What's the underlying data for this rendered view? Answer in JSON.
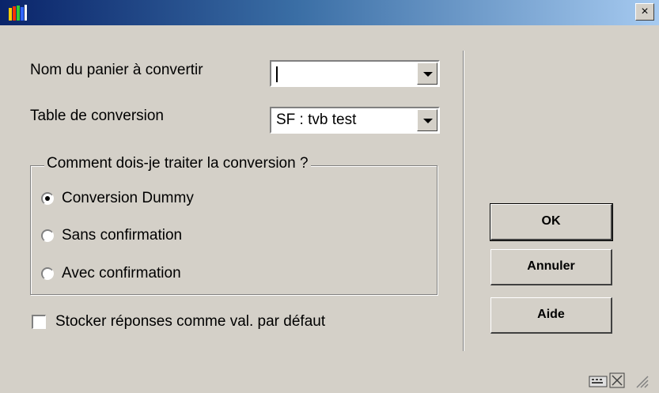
{
  "window": {
    "title": "",
    "close_label": "×"
  },
  "form": {
    "basket_label": "Nom du panier à convertir",
    "basket_value": "",
    "table_label": "Table de conversion",
    "table_value": "SF : tvb test"
  },
  "group": {
    "legend": "Comment dois-je traiter la conversion ?",
    "options": [
      {
        "label": "Conversion Dummy",
        "selected": true
      },
      {
        "label": "Sans confirmation",
        "selected": false
      },
      {
        "label": "Avec confirmation",
        "selected": false
      }
    ]
  },
  "checkbox": {
    "label": "Stocker réponses comme val. par défaut",
    "checked": false
  },
  "buttons": {
    "ok": "OK",
    "cancel": "Annuler",
    "help": "Aide"
  },
  "icons": {
    "app": "library-books-icon",
    "keyboard": "keyboard-icon",
    "maximize": "maximize-icon",
    "grip": "resize-grip-icon"
  }
}
